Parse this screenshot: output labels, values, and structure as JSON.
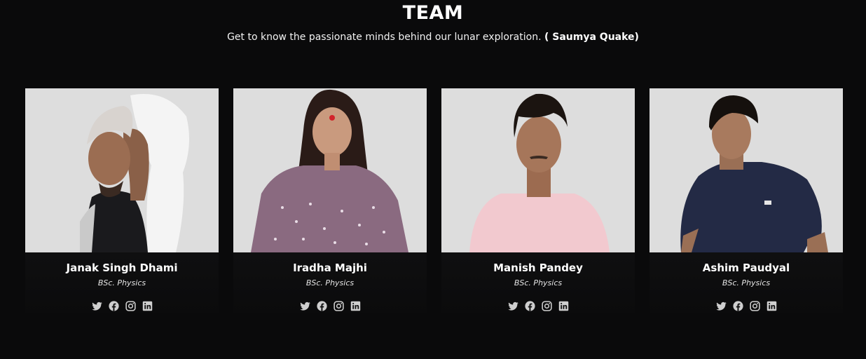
{
  "header": {
    "title": "TEAM",
    "subtitle": "Get to know the passionate minds behind our lunar exploration.",
    "subtitle_credit": "( Saumya Quake)"
  },
  "team": [
    {
      "name": "Janak Singh Dhami",
      "degree": "BSc. Physics"
    },
    {
      "name": "Iradha Majhi",
      "degree": "BSc. Physics"
    },
    {
      "name": "Manish Pandey",
      "degree": "BSc. Physics"
    },
    {
      "name": "Ashim Paudyal",
      "degree": "BSc. Physics"
    }
  ],
  "social_icons": [
    "twitter-icon",
    "facebook-icon",
    "instagram-icon",
    "linkedin-icon"
  ],
  "colors": {
    "background": "#0a0a0b",
    "photo_background": "#dcdcdc",
    "icon": "#cfcfcf"
  }
}
